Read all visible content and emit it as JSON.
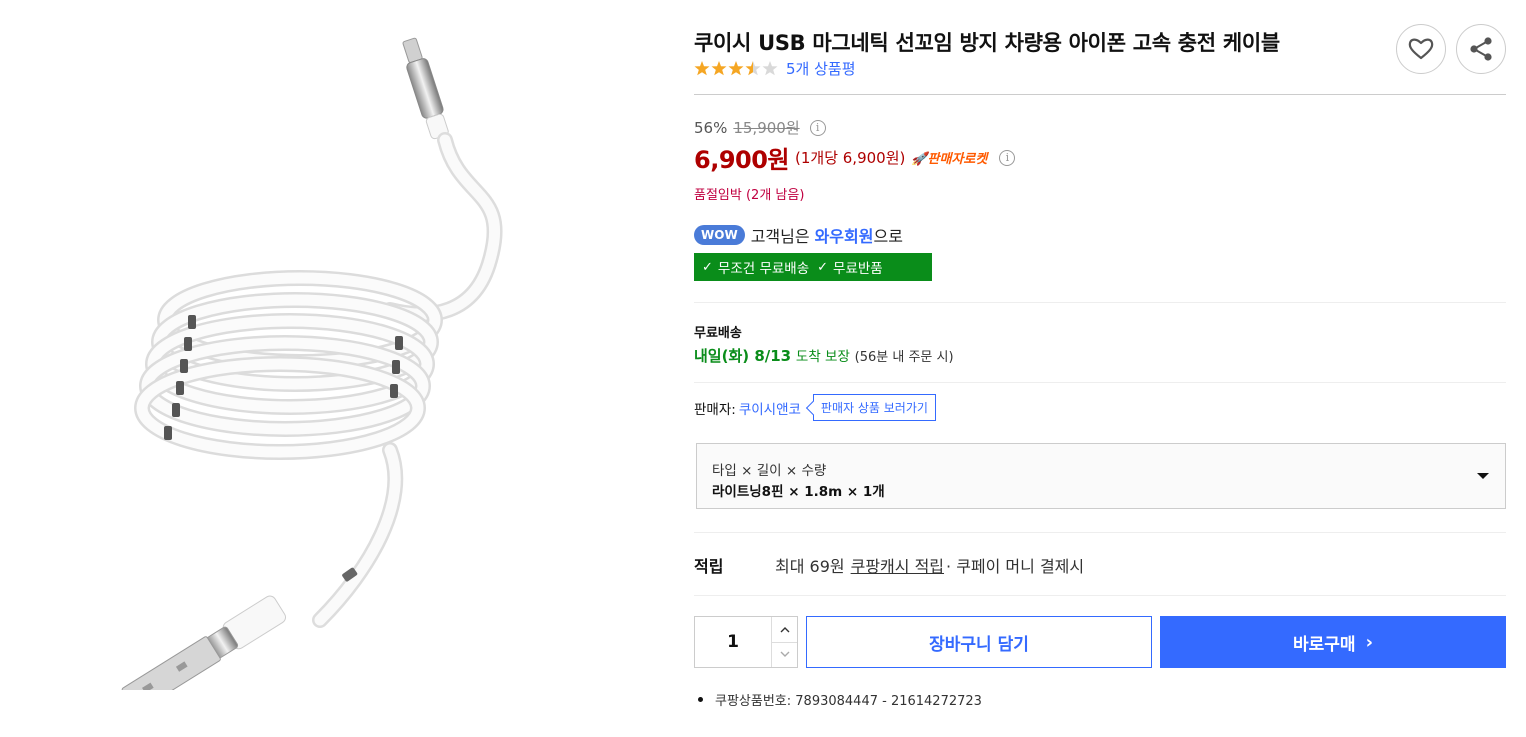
{
  "product": {
    "title": "쿠이시 USB 마그네틱 선꼬임 방지 차량용 아이폰 고속 충전 케이블",
    "rating": 3.5,
    "review_count": "5개 상품평",
    "image_alt": "white magnetic coiled charging cable"
  },
  "actions": {
    "wishlist_icon": "heart-icon",
    "share_icon": "share-icon"
  },
  "pricing": {
    "discount_rate": "56%",
    "original_price": "15,900원",
    "sale_price": "6,900원",
    "unit_price": "(1개당 6,900원)",
    "badge": "🚀판매자로켓",
    "info_glyph": "i",
    "stock_notice": "품절임박 (2개 남음)"
  },
  "membership": {
    "badge": "WOW",
    "text_before": "고객님은",
    "member_name": "와우회원",
    "text_after": "으로",
    "benefits": [
      "무조건 무료배송",
      "무료반품"
    ],
    "accent_color": "#0a8d1a"
  },
  "shipping": {
    "label": "무료배송",
    "date": "내일(화) 8/13",
    "guarantee": "도착 보장",
    "note": "(56분 내 주문 시)"
  },
  "seller": {
    "label": "판매자:",
    "name": "쿠이시앤코",
    "button": "판매자 상품 보러가기"
  },
  "option": {
    "label": "타입 × 길이 × 수량",
    "value": "라이트닝8핀 × 1.8m × 1개"
  },
  "reward": {
    "label": "적립",
    "text_before": "최대 69원",
    "link": "쿠팡캐시 적립",
    "text_after": "· 쿠페이 머니 결제시"
  },
  "purchase": {
    "quantity": "1",
    "cart_label": "장바구니 담기",
    "buy_label": "바로구매",
    "buy_chevron": "›"
  },
  "product_number": "쿠팡상품번호: 7893084447 - 21614272723"
}
